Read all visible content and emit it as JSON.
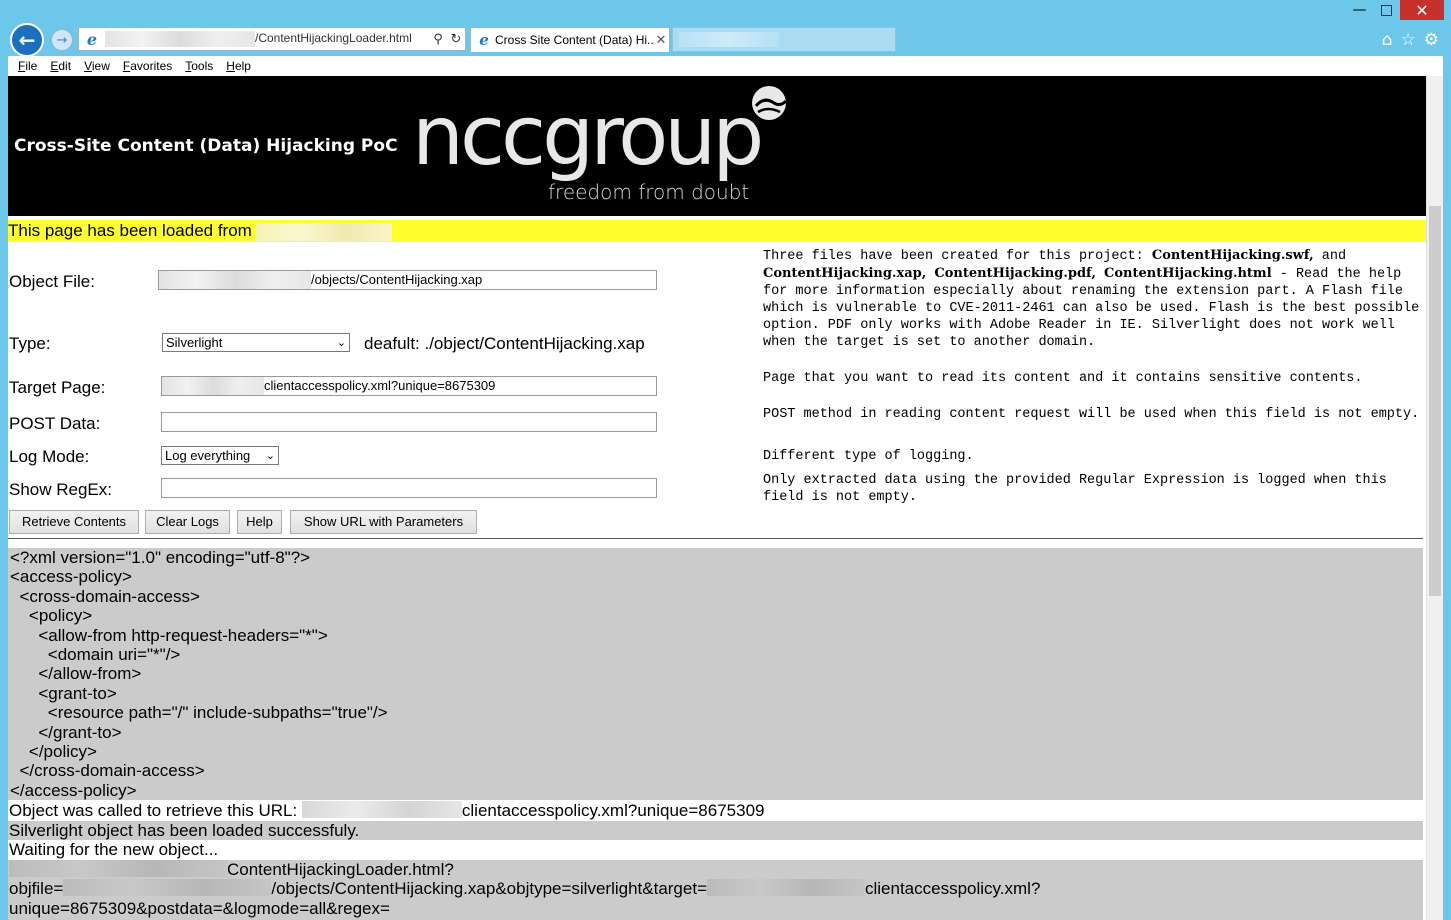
{
  "browser": {
    "address_url": "/ContentHijackingLoader.html",
    "tab_title": "Cross Site Content (Data) Hi...",
    "menu": [
      "File",
      "Edit",
      "View",
      "Favorites",
      "Tools",
      "Help"
    ]
  },
  "page": {
    "banner_title": "Cross-Site Content (Data) Hijacking PoC",
    "logo_text": "nccgroup",
    "logo_tagline": "freedom from doubt",
    "loaded_from": "This page has been loaded from",
    "form": {
      "object_file_label": "Object File:",
      "object_file_value": "/objects/ContentHijacking.xap",
      "type_label": "Type:",
      "type_value": "Silverlight",
      "type_default": "deafult: ./object/ContentHijacking.xap",
      "target_label": "Target Page:",
      "target_value": "clientaccesspolicy.xml?unique=8675309",
      "post_label": "POST Data:",
      "post_value": "",
      "logmode_label": "Log Mode:",
      "logmode_value": "Log everything",
      "regex_label": "Show RegEx:",
      "regex_value": ""
    },
    "help": {
      "intro_1": "Three files have been created for this project: ",
      "file_swf": "ContentHijacking.swf,",
      "and": " and ",
      "file_xap": "ContentHijacking.xap,",
      "file_pdf": "ContentHijacking.pdf,",
      "file_html": "ContentHijacking.html",
      "intro_2": " - Read the help for more information especially about renaming the extension part. A Flash file which is vulnerable to CVE-2011-2461 can also be used. Flash is the best possible option. PDF only works with Adobe Reader in IE. Silverlight does not work well when the target is set to another domain.",
      "target": "Page that you want to read its content and it contains sensitive contents.",
      "post": "POST method in reading content request will be used when this field is not empty.",
      "logmode": "Different type of logging.",
      "regex": "Only extracted data using the provided Regular Expression is logged when this field is not empty."
    },
    "buttons": {
      "retrieve": "Retrieve Contents",
      "clear": "Clear Logs",
      "help": "Help",
      "show_url": "Show URL with Parameters"
    },
    "xml_output": "<?xml version=\"1.0\" encoding=\"utf-8\"?>\n<access-policy>\n  <cross-domain-access>\n    <policy>\n      <allow-from http-request-headers=\"*\">\n        <domain uri=\"*\"/>\n      </allow-from>\n      <grant-to>\n        <resource path=\"/\" include-subpaths=\"true\"/>\n      </grant-to>\n    </policy>\n  </cross-domain-access>\n</access-policy>",
    "log": {
      "line1_prefix": "Object was called to retrieve this URL: ",
      "line1_suffix": "clientaccesspolicy.xml?unique=8675309",
      "line2": "Silverlight object has been loaded successfuly.",
      "line3": "Waiting for the new object...",
      "line4_suffix": "ContentHijackingLoader.html?",
      "line5_prefix": "objfile=",
      "line5_mid": "/objects/ContentHijacking.xap&objtype=silverlight&target=",
      "line5_suffix": "clientaccesspolicy.xml?",
      "line6": "unique=8675309&postdata=&logmode=all&regex="
    }
  }
}
